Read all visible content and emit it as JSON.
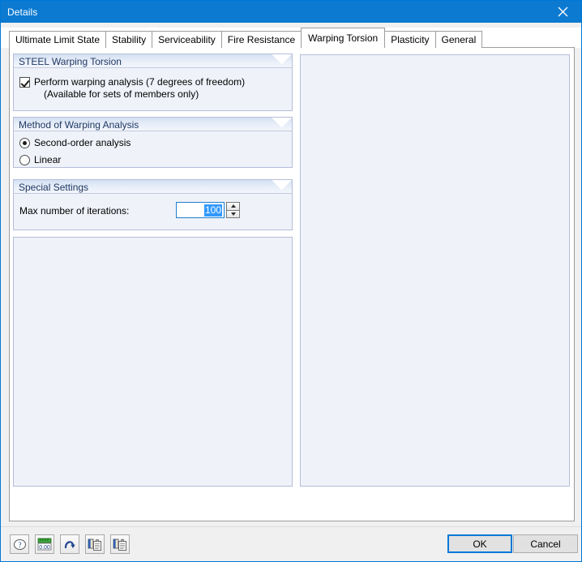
{
  "window": {
    "title": "Details",
    "close_icon": "close-icon"
  },
  "tabs": [
    {
      "label": "Ultimate Limit State",
      "active": false
    },
    {
      "label": "Stability",
      "active": false
    },
    {
      "label": "Serviceability",
      "active": false
    },
    {
      "label": "Fire Resistance",
      "active": false
    },
    {
      "label": "Warping Torsion",
      "active": true
    },
    {
      "label": "Plasticity",
      "active": false
    },
    {
      "label": "General",
      "active": false
    }
  ],
  "groups": {
    "steel_warping_torsion": {
      "title": "STEEL Warping Torsion",
      "checkbox": {
        "label": "Perform warping analysis (7 degrees of freedom)",
        "sublabel": "(Available for sets of members only)",
        "checked": true
      }
    },
    "method_of_warping_analysis": {
      "title": "Method of Warping Analysis",
      "options": [
        {
          "label": "Second-order analysis",
          "selected": true
        },
        {
          "label": "Linear",
          "selected": false
        }
      ]
    },
    "special_settings": {
      "title": "Special Settings",
      "iterations_label": "Max number of iterations:",
      "iterations_value": "100"
    }
  },
  "footer": {
    "tools": [
      {
        "name": "help-icon",
        "title": "Help"
      },
      {
        "name": "units-icon",
        "title": "Units and Decimal Places"
      },
      {
        "name": "undo-icon",
        "title": "Set Default Values"
      },
      {
        "name": "copy-icon",
        "title": "Copy"
      },
      {
        "name": "paste-icon",
        "title": "Paste"
      }
    ],
    "ok_label": "OK",
    "cancel_label": "Cancel"
  },
  "colors": {
    "titlebar": "#0b7ad0",
    "accent": "#0078d7",
    "group_bg": "#eff2f9",
    "group_border": "#b6bdd8",
    "group_title_text": "#1f3864",
    "selection": "#3399ff"
  }
}
